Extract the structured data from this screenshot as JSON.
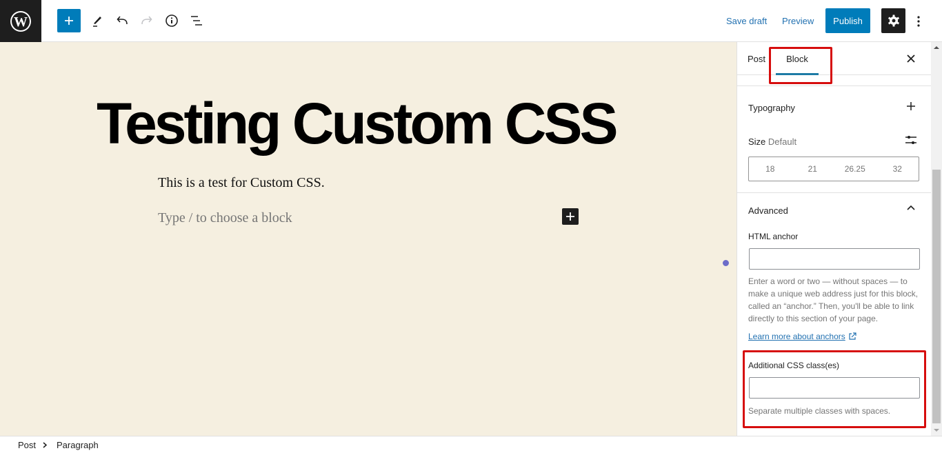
{
  "toolbar": {
    "logo": "wordpress-logo",
    "icons": [
      "plus-icon",
      "pencil-icon",
      "undo-icon",
      "redo-icon",
      "info-icon",
      "list-view-icon"
    ],
    "save_draft": "Save draft",
    "preview": "Preview",
    "publish": "Publish",
    "settings_icon": "gear-icon",
    "more_icon": "more-vertical-icon"
  },
  "editor": {
    "title": "Testing Custom CSS",
    "paragraph": "This is a test for Custom CSS.",
    "placeholder": "Type / to choose a block",
    "background_color": "#f5efe0"
  },
  "sidebar": {
    "tabs": [
      {
        "label": "Post",
        "active": false
      },
      {
        "label": "Block",
        "active": true
      }
    ],
    "typography": {
      "title": "Typography",
      "size_label": "Size",
      "size_value": "Default",
      "size_options": [
        "18",
        "21",
        "26.25",
        "32"
      ]
    },
    "advanced": {
      "title": "Advanced",
      "html_anchor_label": "HTML anchor",
      "html_anchor_value": "",
      "html_anchor_help": "Enter a word or two — without spaces — to make a unique web address just for this block, called an “anchor.” Then, you'll be able to link directly to this section of your page.",
      "learn_more": "Learn more about anchors",
      "css_class_label": "Additional CSS class(es)",
      "css_class_value": "",
      "css_class_help": "Separate multiple classes with spaces."
    }
  },
  "breadcrumb": {
    "items": [
      "Post",
      "Paragraph"
    ]
  },
  "colors": {
    "accent": "#007cba",
    "highlight": "#d60d0d",
    "tab_indicator": "#1d7ba5"
  }
}
